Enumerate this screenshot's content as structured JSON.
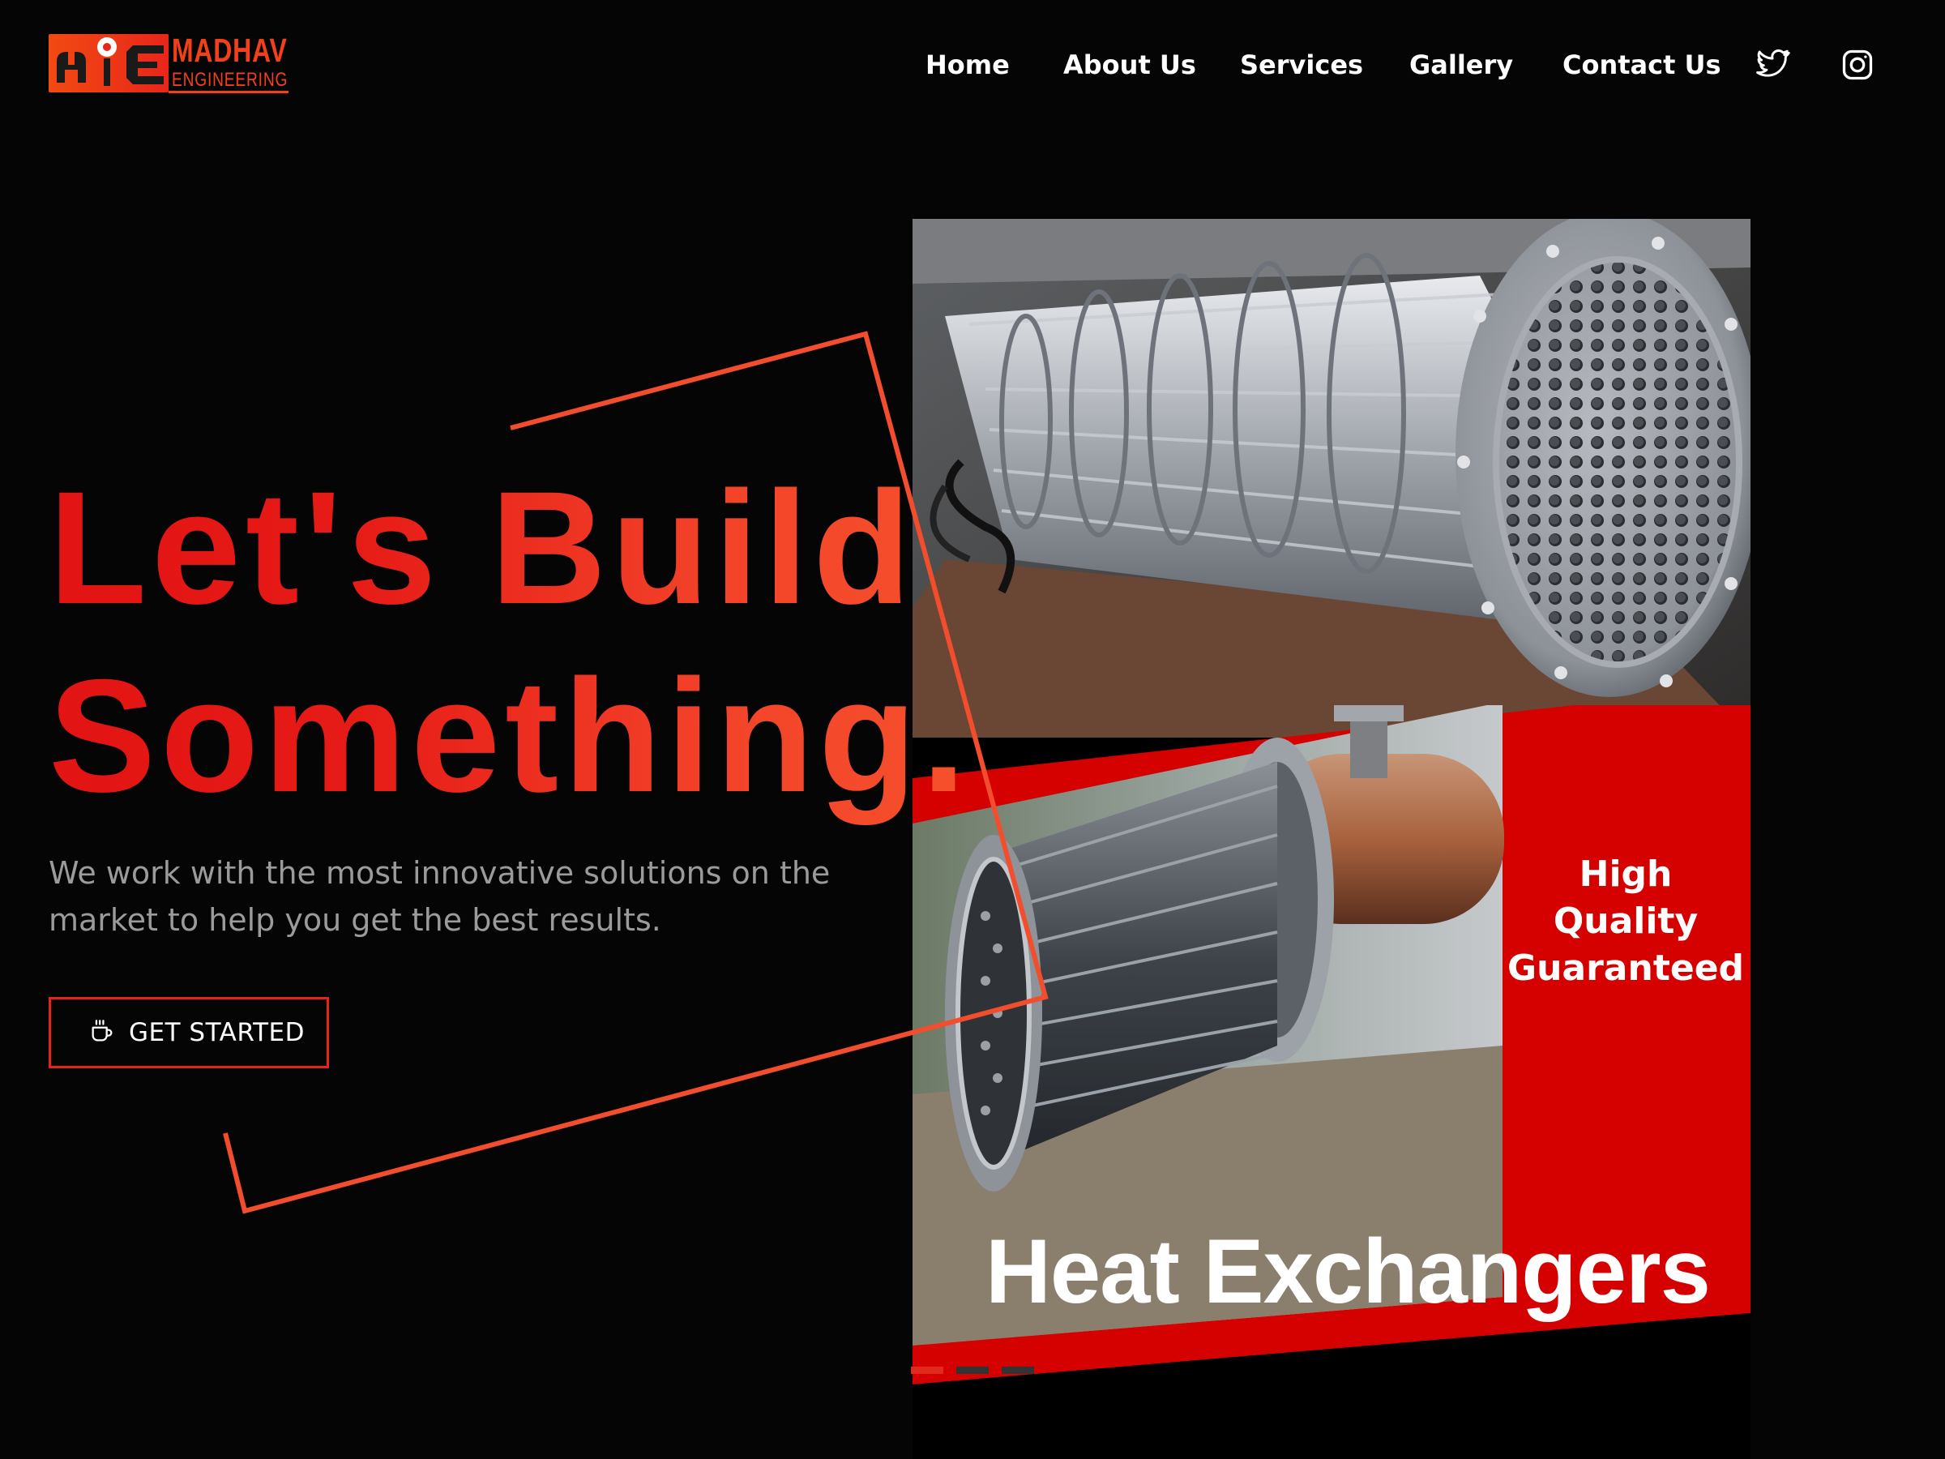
{
  "brand": {
    "name_line1": "MADHAV",
    "name_line2": "ENGINEERING"
  },
  "nav": {
    "items": [
      {
        "label": "Home"
      },
      {
        "label": "About Us"
      },
      {
        "label": "Services"
      },
      {
        "label": "Gallery"
      },
      {
        "label": "Contact Us"
      }
    ],
    "social_icons": [
      "twitter-icon",
      "instagram-icon"
    ]
  },
  "hero": {
    "title_line1": "Let's Build",
    "title_line2": "Something.",
    "subtitle": "We work with the most innovative solutions on the market to help you get the best results.",
    "cta_label": "GET STARTED",
    "cta_icon": "coffee-cup-icon"
  },
  "slider": {
    "badge_line1": "High Quality",
    "badge_line2": "Guaranteed",
    "caption": "Heat Exchangers",
    "slide_count": 3,
    "active_slide": 1
  },
  "colors": {
    "background": "#050505",
    "accent": "#e5231c",
    "accent_orange": "#f4502a",
    "subtitle_gray": "#9b9b9b"
  }
}
